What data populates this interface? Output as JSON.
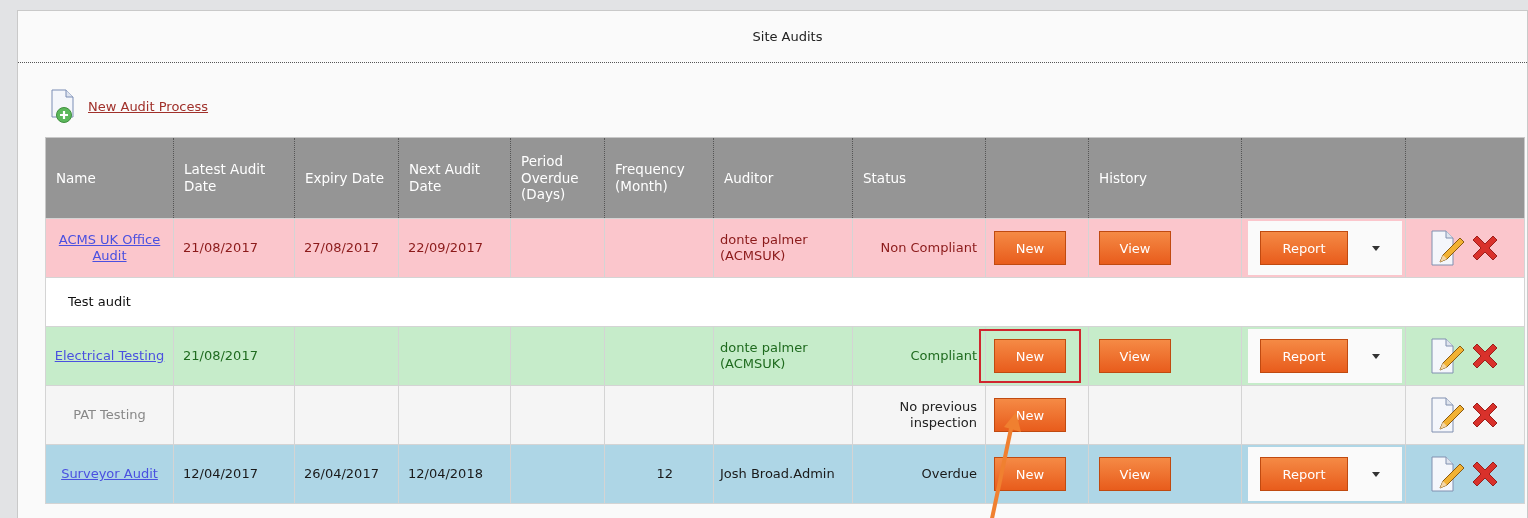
{
  "panel": {
    "title": "Site Audits"
  },
  "new_process_link": "New Audit Process",
  "table": {
    "columns": [
      "Name",
      "Latest Audit Date",
      "Expiry Date",
      "Next Audit Date",
      "Period Overdue (Days)",
      "Frequency (Month)",
      "Auditor",
      "Status",
      "",
      "History",
      "",
      ""
    ],
    "rows": [
      {
        "kind": "noncompliant",
        "color": "#fbc6cc",
        "name": "ACMS UK Office Audit",
        "name_link": true,
        "latest": "21/08/2017",
        "expiry": "27/08/2017",
        "next": "22/09/2017",
        "overdue": "",
        "frequency": "",
        "auditor": "donte palmer (ACMSUK)",
        "status": "Non Compliant",
        "new_button": "New",
        "highlighted": false,
        "view_button": "View",
        "report_button": "Report"
      },
      {
        "kind": "group",
        "name": "Test audit"
      },
      {
        "kind": "compliant",
        "color": "#c6ecca",
        "name": "Electrical Testing",
        "name_link": true,
        "latest": "21/08/2017",
        "expiry": "",
        "next": "",
        "overdue": "",
        "frequency": "",
        "auditor": "donte palmer (ACMSUK)",
        "status": "Compliant",
        "new_button": "New",
        "highlighted": true,
        "view_button": "View",
        "report_button": "Report"
      },
      {
        "kind": "uninspected",
        "color": "#f5f5f5",
        "name": "PAT Testing",
        "name_link": false,
        "latest": "",
        "expiry": "",
        "next": "",
        "overdue": "",
        "frequency": "",
        "auditor": "",
        "status": "No previous inspection",
        "new_button": "New",
        "highlighted": false
      },
      {
        "kind": "overdue",
        "color": "#aed6e6",
        "name": "Surveyor Audit",
        "name_link": true,
        "latest": "12/04/2017",
        "expiry": "26/04/2017",
        "next": "12/04/2018",
        "overdue": "",
        "frequency": "12",
        "auditor": "Josh Broad.Admin",
        "status": "Overdue",
        "new_button": "New",
        "highlighted": false,
        "view_button": "View",
        "report_button": "Report"
      }
    ]
  }
}
